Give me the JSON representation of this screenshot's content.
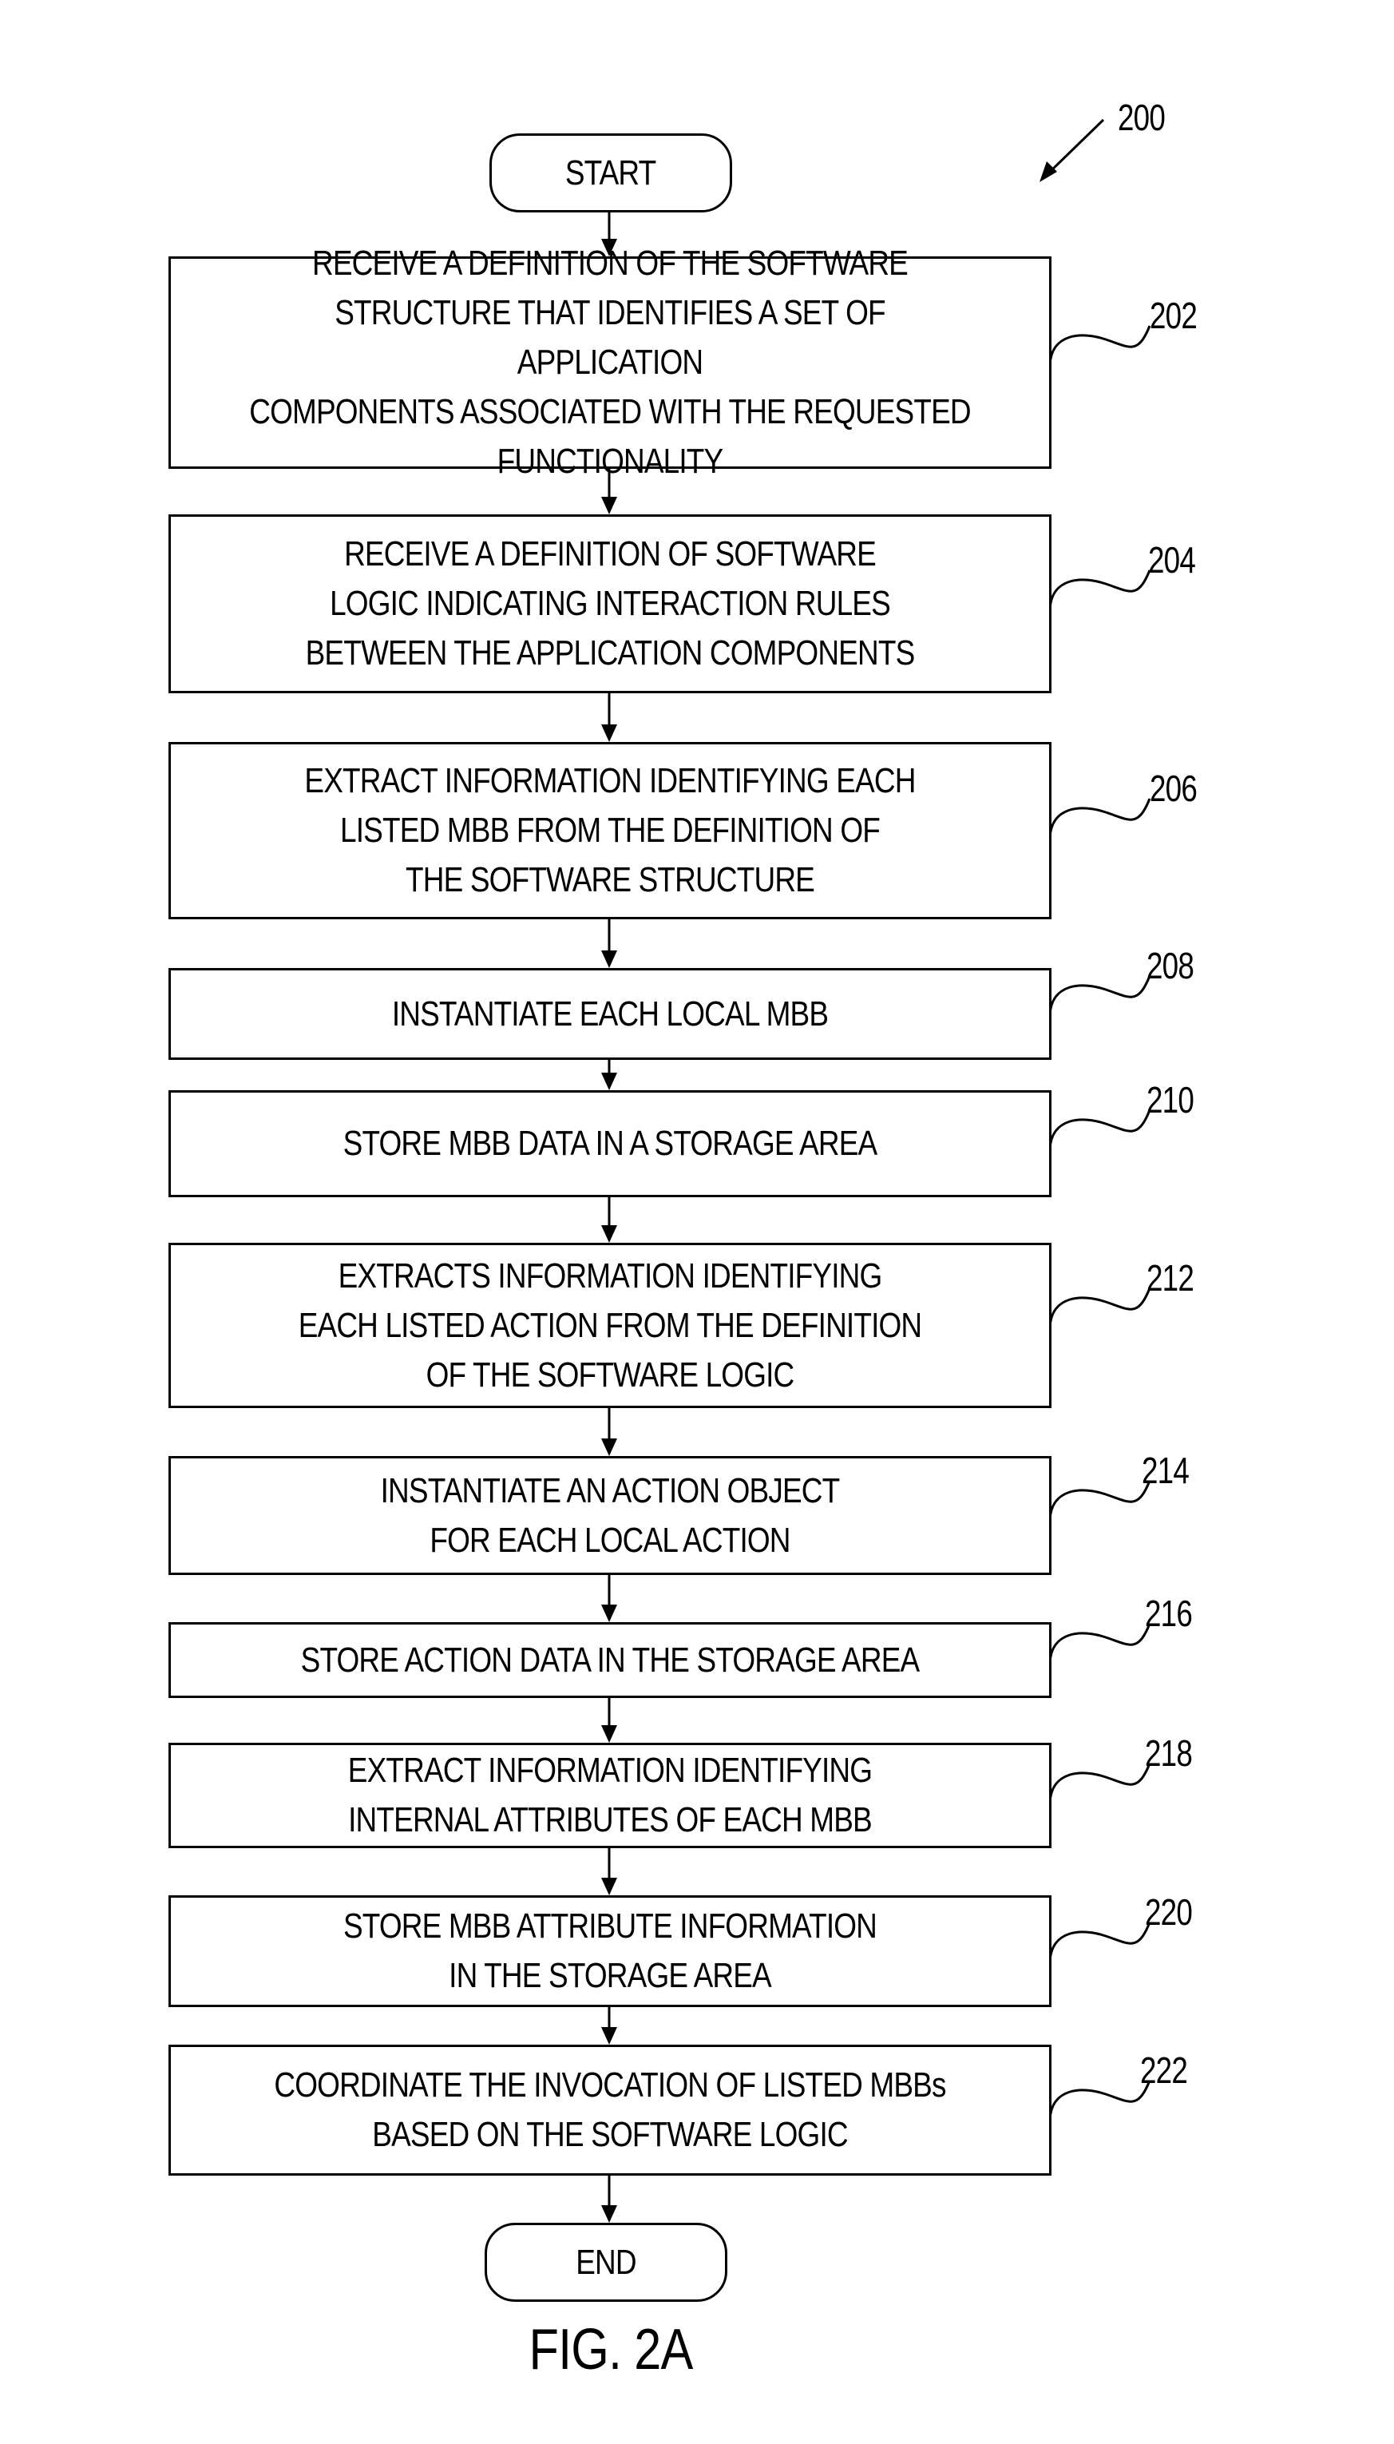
{
  "figure": {
    "caption": "FIG. 2A",
    "reference_numeral": "200"
  },
  "terminals": {
    "start": "START",
    "end": "END"
  },
  "steps": [
    {
      "ref": "202",
      "text": "RECEIVE A DEFINITION OF THE SOFTWARE\nSTRUCTURE THAT IDENTIFIES A SET OF APPLICATION\nCOMPONENTS ASSOCIATED WITH THE REQUESTED\nFUNCTIONALITY"
    },
    {
      "ref": "204",
      "text": "RECEIVE A DEFINITION OF SOFTWARE\nLOGIC INDICATING INTERACTION RULES\nBETWEEN THE APPLICATION COMPONENTS"
    },
    {
      "ref": "206",
      "text": "EXTRACT INFORMATION IDENTIFYING EACH\nLISTED MBB FROM THE DEFINITION OF\nTHE SOFTWARE STRUCTURE"
    },
    {
      "ref": "208",
      "text": "INSTANTIATE EACH LOCAL MBB"
    },
    {
      "ref": "210",
      "text": "STORE MBB DATA IN A STORAGE AREA"
    },
    {
      "ref": "212",
      "text": "EXTRACTS INFORMATION IDENTIFYING\nEACH LISTED ACTION FROM THE DEFINITION\nOF THE SOFTWARE LOGIC"
    },
    {
      "ref": "214",
      "text": "INSTANTIATE AN ACTION OBJECT\nFOR EACH LOCAL ACTION"
    },
    {
      "ref": "216",
      "text": "STORE ACTION DATA IN THE STORAGE AREA"
    },
    {
      "ref": "218",
      "text": "EXTRACT INFORMATION IDENTIFYING\nINTERNAL ATTRIBUTES OF EACH MBB"
    },
    {
      "ref": "220",
      "text": "STORE MBB ATTRIBUTE INFORMATION\nIN THE STORAGE AREA"
    },
    {
      "ref": "222",
      "text": "COORDINATE THE INVOCATION OF LISTED MBBs\nBASED ON THE SOFTWARE LOGIC"
    }
  ]
}
